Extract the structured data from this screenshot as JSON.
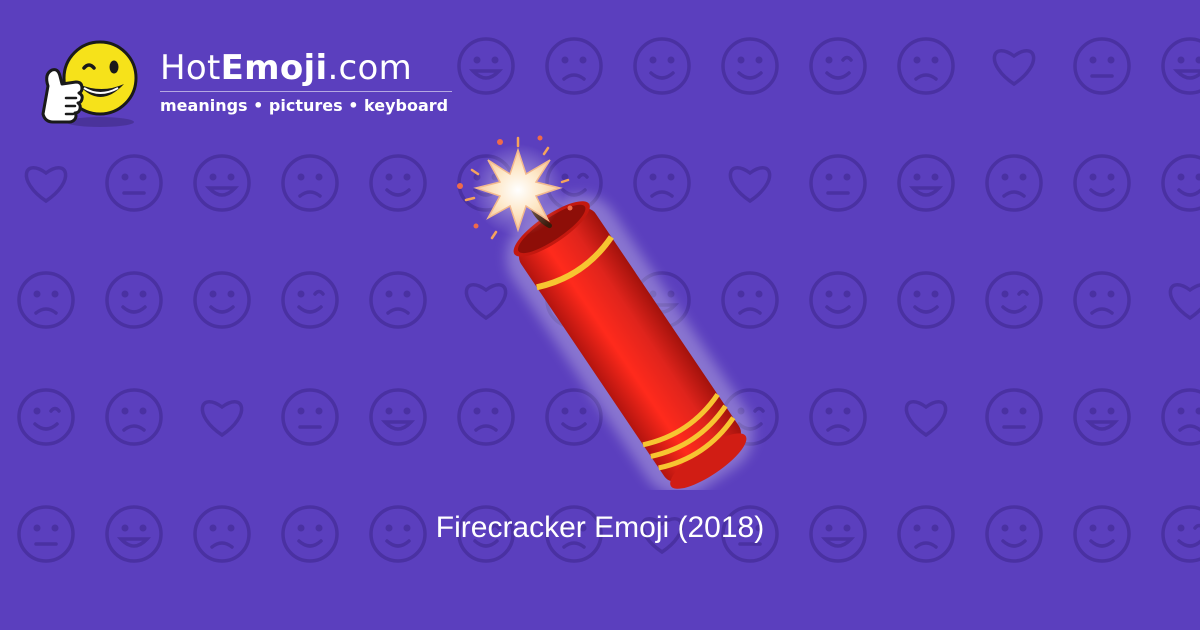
{
  "brand": {
    "name_prefix": "Hot",
    "name_bold": "Emoji",
    "name_suffix": ".com",
    "tagline": "meanings • pictures • keyboard",
    "logo_icon": "winking-thumbs-up-smiley-icon"
  },
  "hero": {
    "icon": "firecracker-icon",
    "caption": "Firecracker Emoji (2018)"
  },
  "colors": {
    "background": "#5b3fbe",
    "pattern": "#4a31a2",
    "firecracker_red": "#e0241c",
    "firecracker_band": "#f7c531",
    "logo_yellow": "#f6e21a"
  }
}
